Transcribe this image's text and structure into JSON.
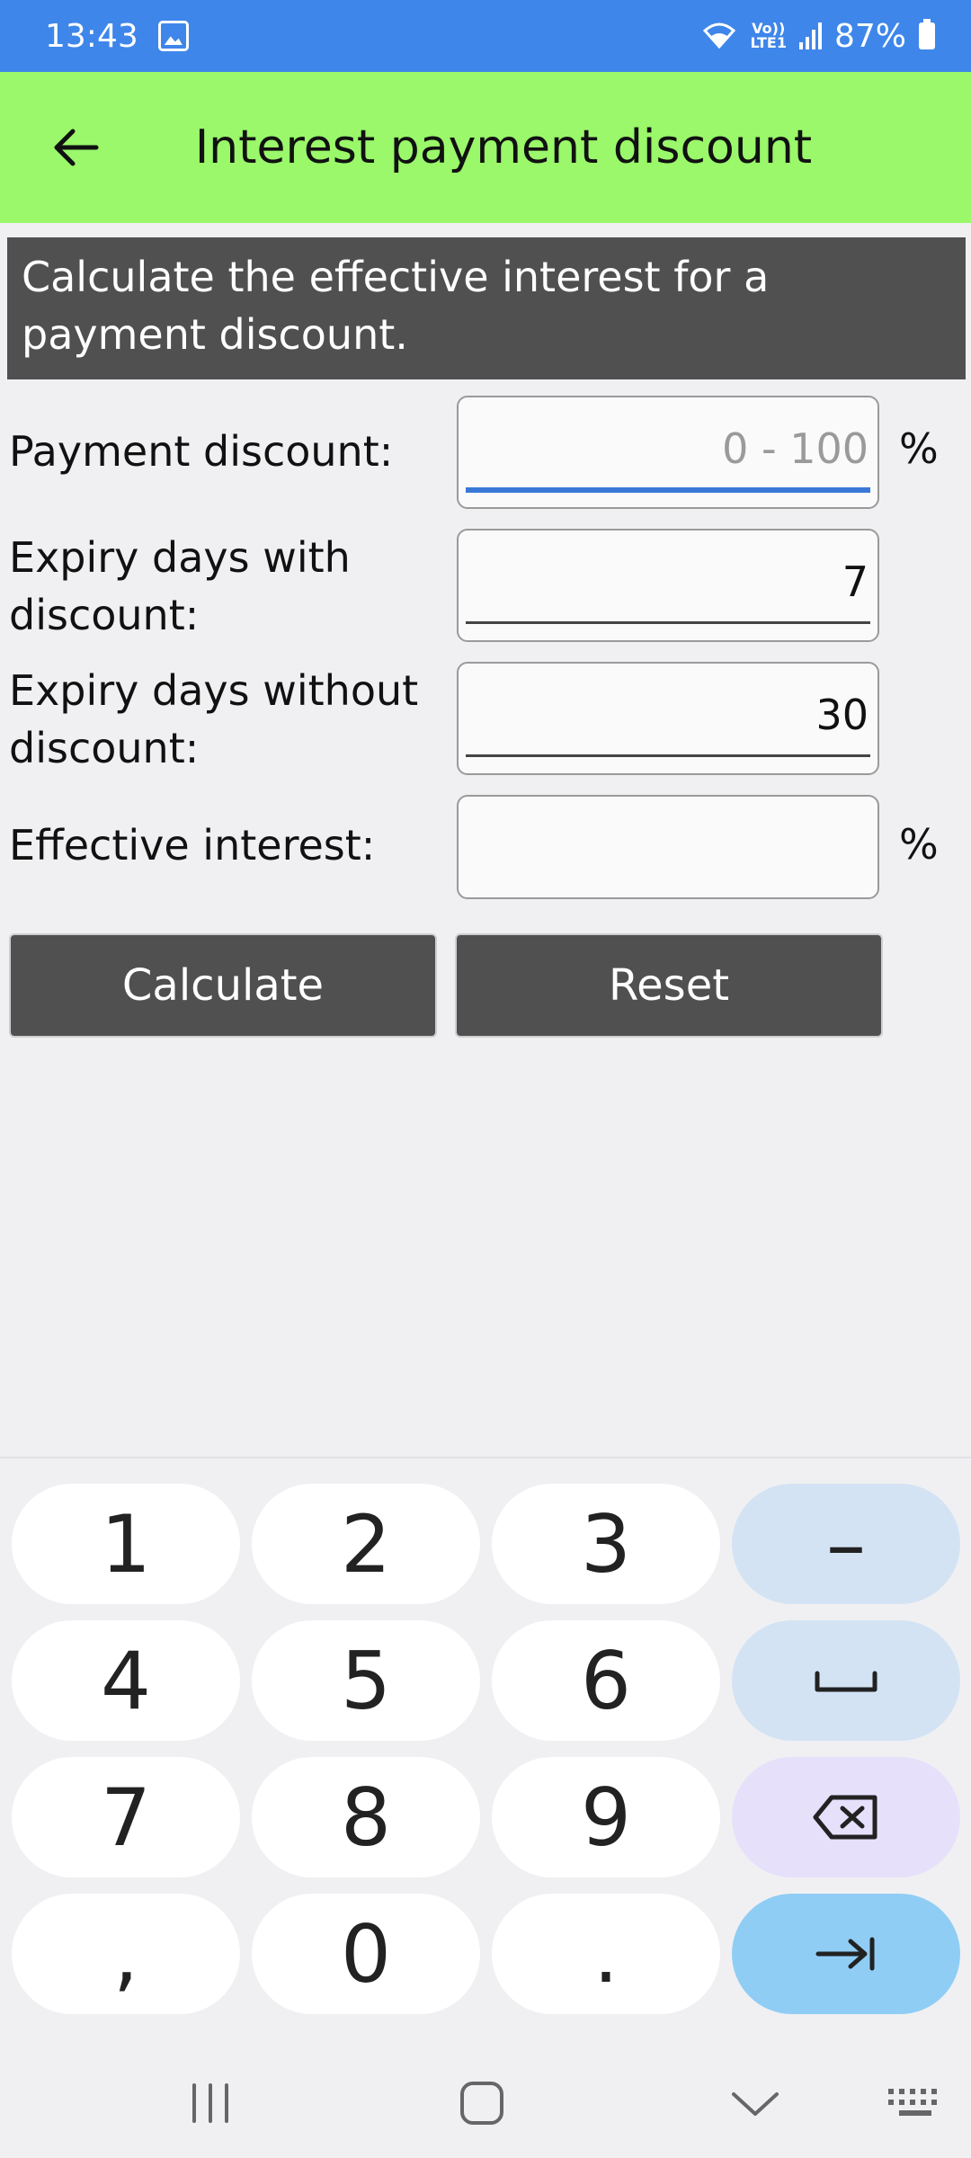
{
  "status_bar": {
    "time": "13:43",
    "volte_line1": "Vo))",
    "volte_line2": "LTE1",
    "battery": "87%"
  },
  "app_bar": {
    "title": "Interest payment discount"
  },
  "info": {
    "text": "Calculate the effective interest for a payment discount."
  },
  "form": {
    "payment_discount": {
      "label": "Payment discount:",
      "value": "",
      "placeholder": "0 - 100",
      "unit": "%"
    },
    "expiry_with": {
      "label_line1": "Expiry days with",
      "label_line2": "discount:",
      "value": "7"
    },
    "expiry_without": {
      "label_line1": "Expiry days without",
      "label_line2": "discount:",
      "value": "30"
    },
    "effective_interest": {
      "label": "Effective interest:",
      "value": "",
      "unit": "%"
    }
  },
  "buttons": {
    "calculate": "Calculate",
    "reset": "Reset"
  },
  "keyboard": {
    "keys": [
      "1",
      "2",
      "3",
      "–",
      "4",
      "5",
      "6",
      "␣",
      "7",
      "8",
      "9",
      "⌫",
      ",",
      "0",
      ".",
      "⇥"
    ]
  }
}
